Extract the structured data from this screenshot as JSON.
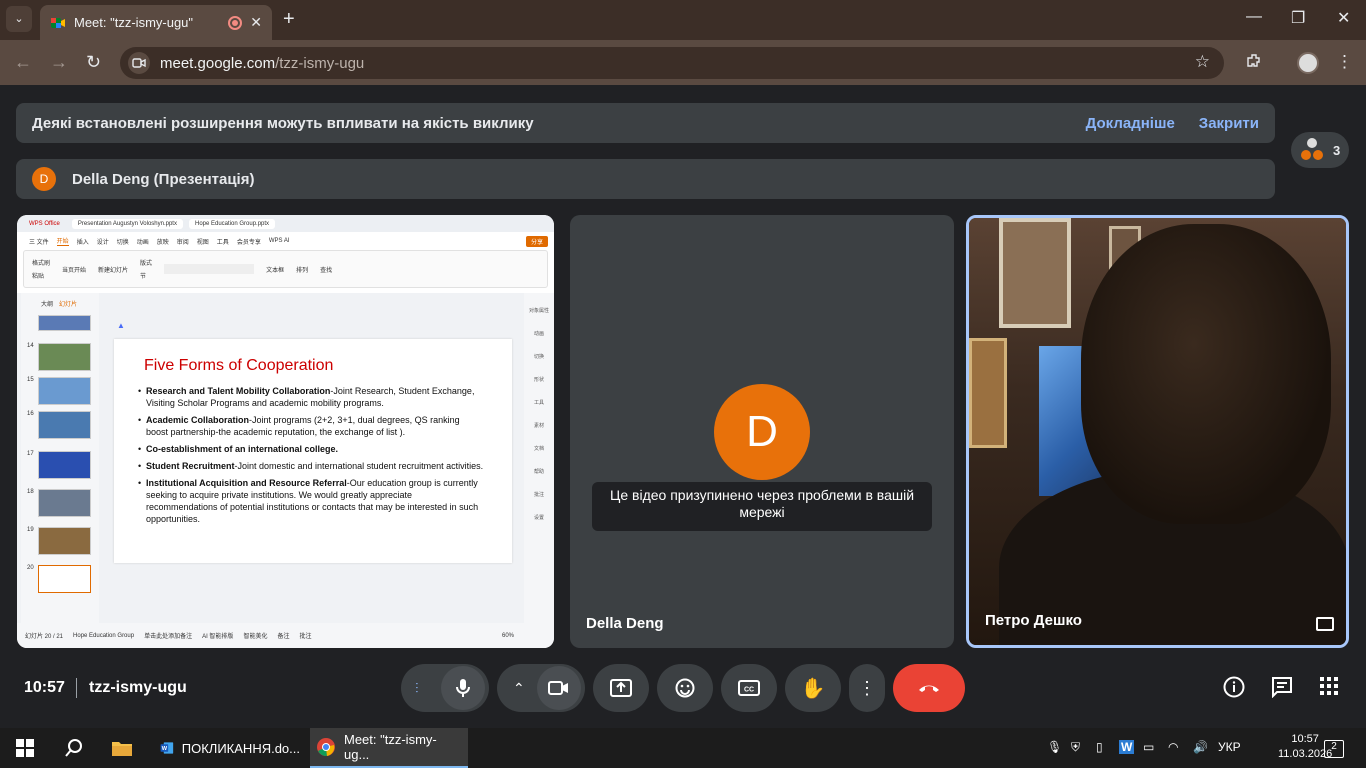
{
  "browser": {
    "tab_title": "Meet: \"tzz-ismy-ugu\"",
    "url_host": "meet.google.com",
    "url_path": "/tzz-ismy-ugu"
  },
  "banner": {
    "message": "Деякі встановлені розширення можуть впливати на якість виклику",
    "learn_more": "Докладніше",
    "close": "Закрити"
  },
  "presentation": {
    "initial": "D",
    "title": "Della Deng (Презентація)"
  },
  "participants": {
    "count": "3"
  },
  "wps": {
    "tabs": [
      "WPS Office",
      "Presentation Augustyn Voloshyn.pptx",
      "Hope Education Group.pptx"
    ],
    "menu": [
      "三 文件",
      "开始",
      "插入",
      "设计",
      "切换",
      "动画",
      "放映",
      "审阅",
      "视图",
      "工具",
      "会员专享",
      "WPS AI"
    ],
    "share": "分享",
    "ribbon": [
      "格式刷",
      "粘贴",
      "当页开始",
      "新建幻灯片",
      "版式",
      "节",
      "文本框",
      "排列",
      "查找"
    ],
    "thumb_tabs": {
      "outline": "大纲",
      "slides": "幻灯片"
    },
    "thumb_numbers": [
      "14",
      "15",
      "16",
      "17",
      "18",
      "19",
      "20"
    ],
    "right_tools": [
      "对象属性",
      "动画",
      "切换",
      "形状",
      "工具",
      "素材",
      "文档",
      "帮助",
      "批注",
      "设置"
    ],
    "status": [
      "幻灯片 20 / 21",
      "Hope Education Group",
      "单击此处添加备注",
      "AI 智能排版",
      "智能美化",
      "备注",
      "批注",
      "60%"
    ],
    "slide": {
      "title": "Five Forms of Cooperation",
      "bullets": [
        {
          "bold": "Research and Talent Mobility Collaboration",
          "text": "-Joint Research, Student Exchange, Visiting Scholar Programs and academic mobility programs."
        },
        {
          "bold": "Academic Collaboration",
          "text": "-Joint programs (2+2, 3+1, dual degrees, QS ranking boost partnership-the academic reputation, the exchange of list )."
        },
        {
          "bold": "Co-establishment of an international college.",
          "text": ""
        },
        {
          "bold": "Student Recruitment",
          "text": "-Joint domestic and international student recruitment activities."
        },
        {
          "bold": "Institutional Acquisition and Resource Referral",
          "text": "-Our education group is currently seeking to acquire private institutions. We would greatly appreciate recommendations of potential institutions or contacts that may be interested in such opportunities."
        }
      ]
    }
  },
  "tiles": {
    "della": {
      "initial": "D",
      "paused": "Це відео призупинено через проблеми в вашій мережі",
      "name": "Della Deng"
    },
    "petro": {
      "name": "Петро Дешко"
    }
  },
  "meeting": {
    "time": "10:57",
    "code": "tzz-ismy-ugu"
  },
  "taskbar": {
    "word": "ПОКЛИКАННЯ.do...",
    "chrome": "Meet: \"tzz-ismy-ug...",
    "lang": "УКР",
    "time": "10:57",
    "date": "11.03.2026",
    "notifications": "2"
  }
}
